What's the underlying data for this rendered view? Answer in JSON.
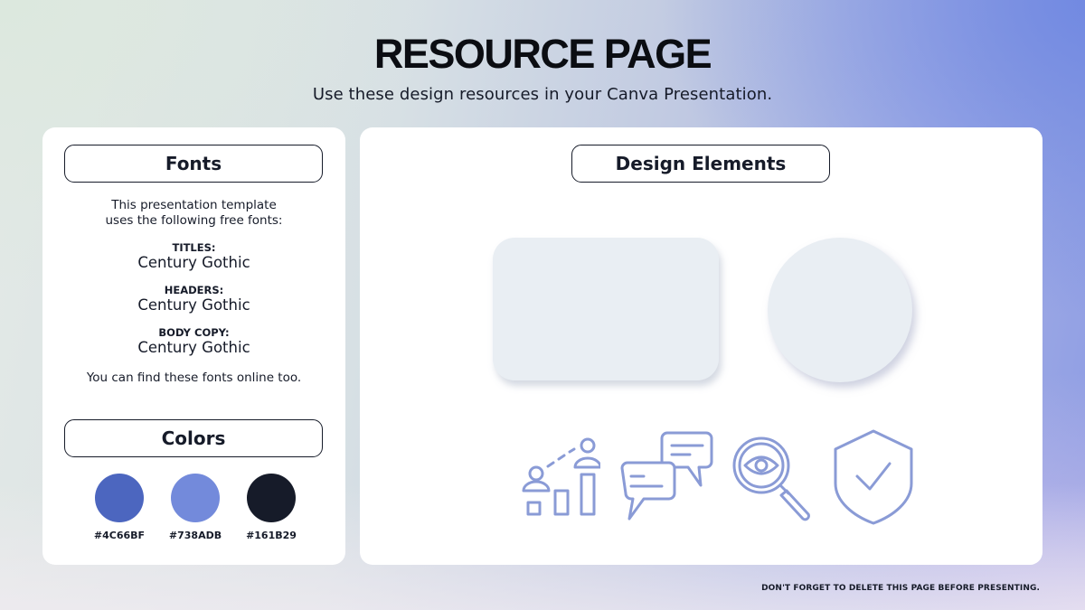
{
  "header": {
    "title": "RESOURCE PAGE",
    "subtitle": "Use these design resources in your Canva Presentation."
  },
  "fonts_panel": {
    "heading": "Fonts",
    "intro_line1": "This presentation template",
    "intro_line2": "uses the following free fonts:",
    "entries": [
      {
        "label": "TITLES:",
        "font": "Century Gothic"
      },
      {
        "label": "HEADERS:",
        "font": "Century Gothic"
      },
      {
        "label": "BODY COPY:",
        "font": "Century Gothic"
      }
    ],
    "outro": "You can find these fonts online too."
  },
  "colors_panel": {
    "heading": "Colors",
    "swatches": [
      {
        "hex": "#4C66BF",
        "color": "#4C66BF"
      },
      {
        "hex": "#738ADB",
        "color": "#738ADB"
      },
      {
        "hex": "#161B29",
        "color": "#161B29"
      }
    ]
  },
  "design_elements": {
    "heading": "Design Elements",
    "shape_fill": "#E9EEF3",
    "icon_color": "#8A9BD6",
    "icons": [
      "growth-people-chart-icon",
      "chat-bubbles-icon",
      "magnifier-eye-icon",
      "shield-check-icon"
    ]
  },
  "footer": {
    "note": "DON'T FORGET TO DELETE THIS PAGE BEFORE PRESENTING."
  }
}
